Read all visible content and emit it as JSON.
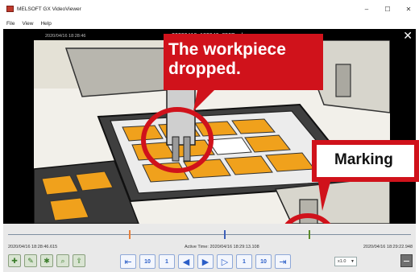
{
  "window": {
    "title": "MELSOFT GX VideoViewer",
    "controls": [
      "–",
      "☐",
      "✕"
    ]
  },
  "menu": [
    "File",
    "View",
    "Help"
  ],
  "video": {
    "filename": "20200416_182846_850D.mkv",
    "overlay_timestamp": "2020/04/16 18:28:46",
    "close_glyph": "✕"
  },
  "callouts": {
    "dropped": "The workpiece dropped.",
    "marking": "Marking"
  },
  "timeline": {
    "start_time": "2020/04/16  18:28:46.615",
    "active_time": "Active Time: 2020/04/16  18:29:13.108",
    "end_time": "2020/04/16  18:29:22.948",
    "markers": [
      {
        "position": 0.3,
        "color": "#e8803a"
      },
      {
        "position": 0.535,
        "color": "#3d5fb8"
      },
      {
        "position": 0.745,
        "color": "#5a8a2a"
      }
    ]
  },
  "tools": [
    "add-marker-icon",
    "edit-marker-icon",
    "settings-icon",
    "search-icon",
    "export-icon"
  ],
  "transport": {
    "rewind_10_label": "10",
    "rewind_1_label": "1",
    "forward_1_label": "1",
    "forward_10_label": "10"
  },
  "speed": {
    "selected": "x1.0"
  }
}
